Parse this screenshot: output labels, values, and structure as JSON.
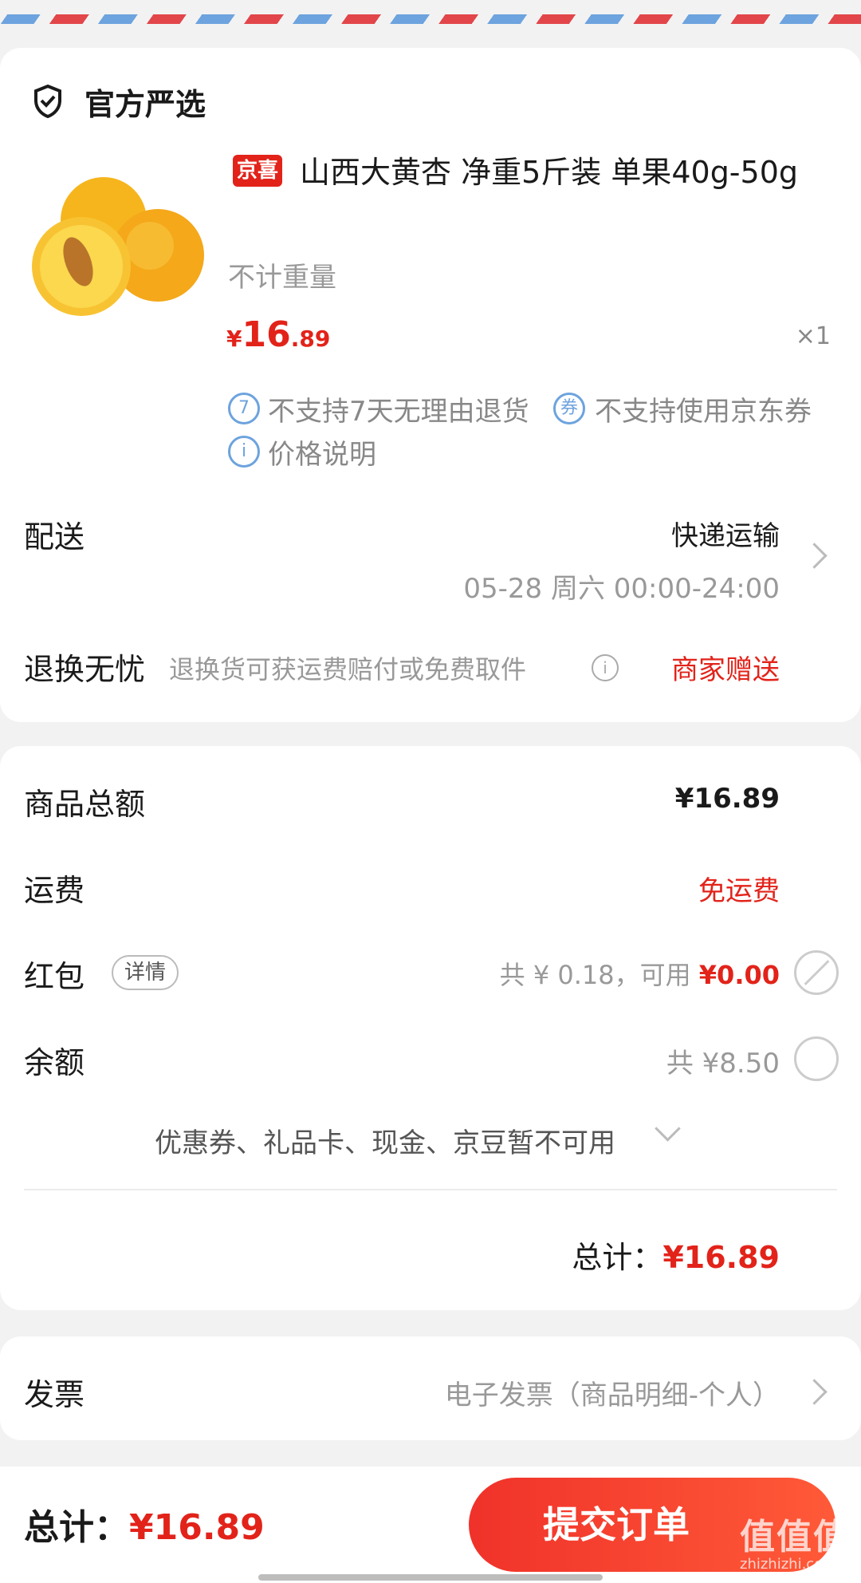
{
  "shop": {
    "title": "官方严选",
    "icon": "shield-check-icon"
  },
  "product": {
    "tag": "京喜",
    "title": "山西大黄杏 净重5斤装 单果40g-50g",
    "spec": "不计重量",
    "price_currency": "¥",
    "price_int": "16",
    "price_dec": ".89",
    "quantity": "×1",
    "services": [
      {
        "icon_text": "7",
        "label": "不支持7天无理由退货"
      },
      {
        "icon_text": "券",
        "label": "不支持使用京东券"
      },
      {
        "icon_text": "i",
        "label": "价格说明"
      }
    ]
  },
  "delivery": {
    "label": "配送",
    "method": "快递运输",
    "time": "05-28 周六 00:00-24:00"
  },
  "returns": {
    "label": "退换无忧",
    "desc": "退换货可获运费赔付或免费取件",
    "value": "商家赠送"
  },
  "summary": {
    "goods_total_label": "商品总额",
    "goods_total_value": "¥16.89",
    "shipping_label": "运费",
    "shipping_value": "免运费",
    "redpacket_label": "红包",
    "redpacket_detail": "详情",
    "redpacket_total": "共 ¥ 0.18，可用",
    "redpacket_available": "¥0.00",
    "balance_label": "余额",
    "balance_total": "共 ¥8.50",
    "unavailable_note": "优惠券、礼品卡、现金、京豆暂不可用",
    "total_label": "总计：",
    "total_value": "¥16.89"
  },
  "invoice": {
    "label": "发票",
    "value": "电子发票（商品明细-个人）"
  },
  "bottom": {
    "total_label": "总计：",
    "total_value": "¥16.89",
    "submit_label": "提交订单"
  },
  "watermark": {
    "text": "值值值",
    "url": "zhizhizhi.com"
  },
  "colors": {
    "accent_red": "#e2231a",
    "airmail_red": "#e2464a",
    "airmail_blue": "#6da3de"
  }
}
